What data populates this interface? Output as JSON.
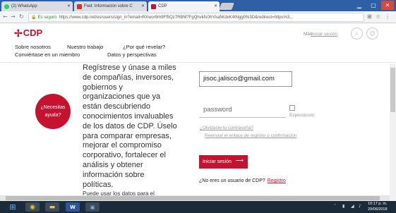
{
  "browser": {
    "tabs": [
      {
        "label": "(2) WhatsApp",
        "icon": "whatsapp-icon",
        "color": "#25d366"
      },
      {
        "label": "Fwd: Información sobre C",
        "icon": "gmail-icon",
        "color": "#d93025"
      },
      {
        "label": "CDP",
        "icon": "cdp-icon",
        "color": "#c4122f"
      }
    ],
    "security_label": "Es seguro",
    "url": "https://www.cdp.net/es/users/sign_in?email=RXwor9m9Ff5Qz7RBM7FgQhvkfs0hYAa5KdxK4tNgg0%3D&redirect=https%3..."
  },
  "header": {
    "logo_text": "CDP",
    "nav": {
      "about": "Sobre nosotros",
      "work": "Nuestro trabajo",
      "why": "¿Por qué revelar?",
      "member": "Conviértase en un miembro",
      "data": "Datos y perspectivas"
    },
    "misc": "Más",
    "login": "Iniciar sesión"
  },
  "main": {
    "badge": {
      "line1": "¿Necesitas",
      "line2": "ayuda?"
    },
    "blurb_lines": [
      "Regístrese y únase a miles",
      "de compañías, inversores,",
      "gobiernos y",
      "organizaciones que ya",
      "están descubriendo",
      "conocimientos invaluables",
      "de los datos de CDP. Úselo",
      "para comparar empresas,",
      "mejorar el compromiso",
      "corporativo, fortalecer el",
      "análisis y obtener",
      "información sobre",
      "políticas."
    ],
    "blurb_small": "Puede usar los datos para el",
    "email_value": "jisoc.jalisco@gmail.com",
    "password_placeholder": "password",
    "show_password": "Espectáculo",
    "forgot_password": "¿Olvidaste tu contraseña?",
    "resend_confirmation": "Reenviar el enlace de registro o confirmación",
    "login_button": "Iniciar sesión",
    "no_user_text": "¿No eres un usuario de CDP?",
    "register_link": "Registro"
  },
  "taskbar": {
    "time": "10:17 p. m.",
    "date": "29/06/2018"
  },
  "colors": {
    "brand": "#c4122f",
    "tabbar": "#2f5fa5",
    "taskbar": "#1c2b3a"
  }
}
